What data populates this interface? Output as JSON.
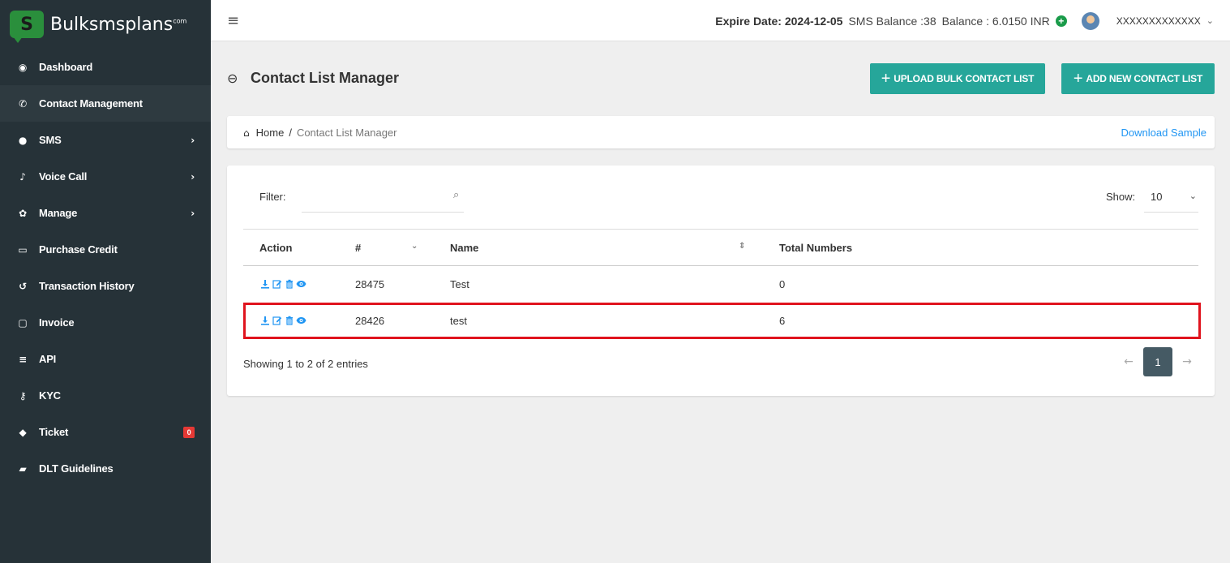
{
  "brand": {
    "name": "Bulksmsplans",
    "suffix": "com",
    "logo_letter": "S"
  },
  "sidebar": {
    "items": [
      {
        "label": "Dashboard",
        "icon": "dashboard-icon",
        "glyph": "◉",
        "active": false,
        "has_chevron": false
      },
      {
        "label": "Contact Management",
        "icon": "phone-icon",
        "glyph": "✆",
        "active": true,
        "has_chevron": false
      },
      {
        "label": "SMS",
        "icon": "chat-bubble-icon",
        "glyph": "●",
        "active": false,
        "has_chevron": true
      },
      {
        "label": "Voice Call",
        "icon": "microphone-icon",
        "glyph": "♪",
        "active": false,
        "has_chevron": true
      },
      {
        "label": "Manage",
        "icon": "gear-icon",
        "glyph": "✿",
        "active": false,
        "has_chevron": true
      },
      {
        "label": "Purchase Credit",
        "icon": "credit-card-icon",
        "glyph": "▭",
        "active": false,
        "has_chevron": false
      },
      {
        "label": "Transaction History",
        "icon": "history-icon",
        "glyph": "↺",
        "active": false,
        "has_chevron": false
      },
      {
        "label": "Invoice",
        "icon": "invoice-icon",
        "glyph": "▢",
        "active": false,
        "has_chevron": false
      },
      {
        "label": "API",
        "icon": "database-icon",
        "glyph": "≡",
        "active": false,
        "has_chevron": false
      },
      {
        "label": "KYC",
        "icon": "key-icon",
        "glyph": "⚷",
        "active": false,
        "has_chevron": false
      },
      {
        "label": "Ticket",
        "icon": "ticket-icon",
        "glyph": "◆",
        "active": false,
        "has_chevron": false,
        "badge": "0"
      },
      {
        "label": "DLT Guidelines",
        "icon": "book-icon",
        "glyph": "▰",
        "active": false,
        "has_chevron": false
      }
    ],
    "chevron": "›"
  },
  "topbar": {
    "menu_glyph": "≡",
    "expire": "Expire Date: 2024-12-05",
    "sms_balance": "SMS Balance :38",
    "balance": "Balance : 6.0150 INR",
    "add_glyph": "+",
    "username": "XXXXXXXXXXXXX",
    "caret": "⌄"
  },
  "page": {
    "back_glyph": "⊖",
    "title": "Contact List Manager",
    "upload_button": "UPLOAD BULK CONTACT LIST",
    "add_button": "ADD NEW CONTACT LIST",
    "plus": "+"
  },
  "breadcrumb": {
    "home_glyph": "⌂",
    "home": "Home",
    "separator": "/",
    "current": "Contact List Manager",
    "download_sample": "Download Sample"
  },
  "table": {
    "filter_label": "Filter:",
    "filter_value": "",
    "search_glyph": "⌕",
    "show_label": "Show:",
    "show_value": "10",
    "show_caret": "⌄",
    "headers": {
      "action": "Action",
      "id": "#",
      "name": "Name",
      "total": "Total Numbers"
    },
    "sort_glyphs": {
      "id": "⌄",
      "name": "⇕"
    },
    "rows": [
      {
        "id": "28475",
        "name": "Test",
        "total": "0",
        "highlighted": false
      },
      {
        "id": "28426",
        "name": "test",
        "total": "6",
        "highlighted": true
      }
    ],
    "showing": "Showing 1 to 2 of 2 entries",
    "pager": {
      "prev": "←",
      "page": "1",
      "next": "→"
    }
  },
  "colors": {
    "sidebar_bg": "#263238",
    "accent": "#26a69a",
    "link": "#2196f3",
    "highlight_border": "#e0141e",
    "pager_active": "#455a64"
  }
}
